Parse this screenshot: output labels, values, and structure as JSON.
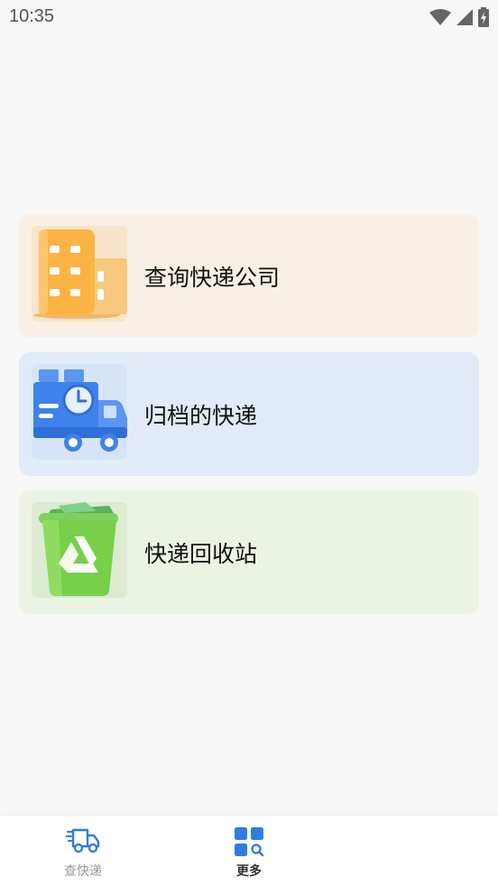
{
  "status_bar": {
    "time": "10:35"
  },
  "cards": [
    {
      "label": "查询快递公司",
      "icon": "office-building-icon",
      "bg_color": "#f8f0e6"
    },
    {
      "label": "归档的快递",
      "icon": "delivery-truck-clock-icon",
      "bg_color": "#e3ebf8"
    },
    {
      "label": "快递回收站",
      "icon": "recycle-bin-icon",
      "bg_color": "#ebf3e5"
    }
  ],
  "bottom_nav": {
    "items": [
      {
        "label": "查快递",
        "icon": "delivery-truck-icon",
        "active": false
      },
      {
        "label": "更多",
        "icon": "grid-search-icon",
        "active": true
      }
    ],
    "active_color": "#2f7de1",
    "inactive_color": "#9a9a9a"
  }
}
